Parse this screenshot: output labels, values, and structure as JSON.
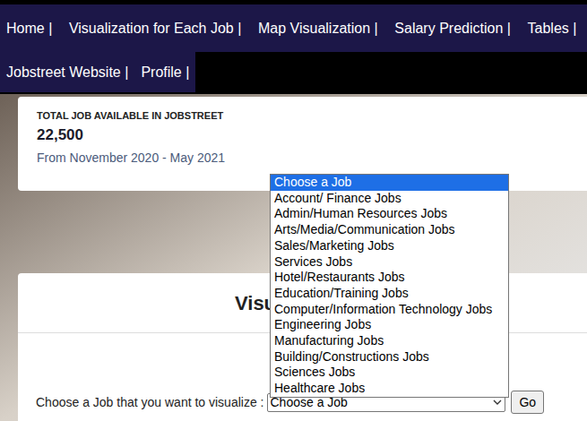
{
  "nav": {
    "rows": [
      [
        {
          "label": "Home |"
        },
        {
          "label": "Visualization for Each Job |"
        },
        {
          "label": "Map Visualization |"
        },
        {
          "label": "Salary Prediction |"
        },
        {
          "label": "Tables |"
        }
      ],
      [
        {
          "label": "Jobstreet Website |"
        },
        {
          "label": "Profile |"
        }
      ]
    ]
  },
  "summary": {
    "label": "TOTAL JOB AVAILABLE IN JOBSTREET",
    "count": "22,500",
    "range": "From November 2020 - May 2021"
  },
  "section": {
    "title": "Visu"
  },
  "form": {
    "label": "Choose a Job that you want to visualize :",
    "select_value": "Choose a Job",
    "expanded": true,
    "button": "Go"
  },
  "dropdown": {
    "options": [
      {
        "label": "Choose a Job",
        "selected": true
      },
      {
        "label": "Account/ Finance Jobs",
        "selected": false
      },
      {
        "label": "Admin/Human Resources Jobs",
        "selected": false
      },
      {
        "label": "Arts/Media/Communication Jobs",
        "selected": false
      },
      {
        "label": "Sales/Marketing Jobs",
        "selected": false
      },
      {
        "label": "Services Jobs",
        "selected": false
      },
      {
        "label": "Hotel/Restaurants Jobs",
        "selected": false
      },
      {
        "label": "Education/Training Jobs",
        "selected": false
      },
      {
        "label": "Computer/Information Technology Jobs",
        "selected": false
      },
      {
        "label": "Engineering Jobs",
        "selected": false
      },
      {
        "label": "Manufacturing Jobs",
        "selected": false
      },
      {
        "label": "Building/Constructions Jobs",
        "selected": false
      },
      {
        "label": "Sciences Jobs",
        "selected": false
      },
      {
        "label": "Healthcare Jobs",
        "selected": false
      }
    ]
  }
}
